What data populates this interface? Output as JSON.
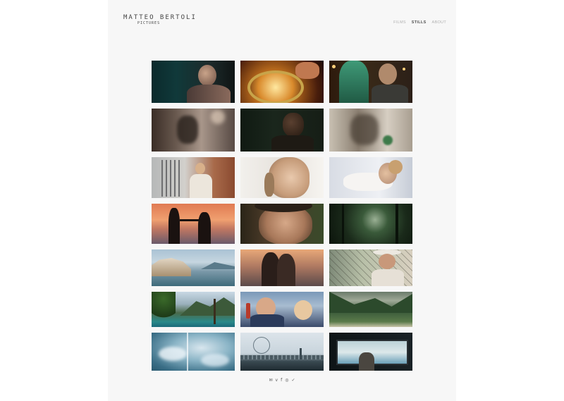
{
  "brand": {
    "name": "MATTEO BERTOLI",
    "tagline": "PICTURES"
  },
  "nav": {
    "items": [
      {
        "label": "FILMS",
        "active": false
      },
      {
        "label": "STILLS",
        "active": true
      },
      {
        "label": "ABOUT",
        "active": false
      }
    ]
  },
  "colors": {
    "page_bg": "#f7f7f7",
    "nav_active": "#555555",
    "nav_inactive": "#b0b0b0"
  },
  "stills": [
    "man-with-eyes-closed-dark-teal",
    "hands-holding-golden-glowing-bowl",
    "green-haired-woman-and-man-bokeh",
    "blurry-city-lights-street",
    "dark-man-face-night",
    "blurry-bokeh-figure",
    "blonde-woman-new-york-bridge",
    "woman-face-close-up-soft-light",
    "woman-sleeping-white-sheets",
    "couple-silhouette-sunset-beach",
    "man-face-looking-up",
    "dark-forest-light-rays",
    "coastal-town-cliffs-sea",
    "couple-kissing-city-dusk",
    "old-man-white-hat-fence",
    "tropical-palms-green-mountains",
    "couple-smiling-drink-bottle",
    "green-valley-mountains-beach",
    "blue-sky-clouds-contrail",
    "ferris-wheel-skyline-water",
    "man-in-subway-train-window"
  ],
  "social": [
    {
      "name": "email-icon",
      "glyph": "✉"
    },
    {
      "name": "vimeo-icon",
      "glyph": "v"
    },
    {
      "name": "facebook-icon",
      "glyph": "f"
    },
    {
      "name": "instagram-icon",
      "glyph": "◎"
    },
    {
      "name": "twitter-icon",
      "glyph": "✓"
    }
  ]
}
